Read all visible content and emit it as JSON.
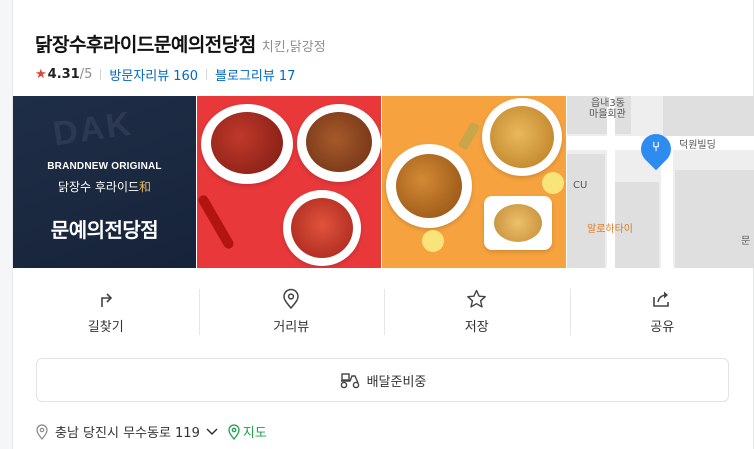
{
  "place": {
    "title": "닭장수후라이드문예의전당점",
    "category": "치킨,닭강정"
  },
  "rating": {
    "star_icon": "star-icon",
    "value": "4.31",
    "max": "/5"
  },
  "reviews": {
    "visit_label": "방문자리뷰",
    "visit_count": "160",
    "blog_label": "블로그리뷰",
    "blog_count": "17"
  },
  "photo_logo": {
    "bg_word": "DAK",
    "brand_line": "BRANDNEW ORIGINAL",
    "sub_line": "닭장수 후라이드",
    "sub_accent": "和",
    "main_line": "문예의전당점"
  },
  "map_thumb": {
    "label_1": "읍내3동",
    "label_2": "마을회관",
    "label_3": "덕원빌딩",
    "label_4": "CU",
    "label_5": "알로하타이",
    "label_6": "문"
  },
  "actions": [
    {
      "label": "길찾기",
      "icon": "directions-icon"
    },
    {
      "label": "거리뷰",
      "icon": "street-view-pin-icon"
    },
    {
      "label": "저장",
      "icon": "star-outline-icon"
    },
    {
      "label": "공유",
      "icon": "share-icon"
    }
  ],
  "delivery": {
    "label": "배달준비중",
    "icon": "delivery-scooter-icon"
  },
  "address": {
    "text": "충남 당진시 무수동로 119",
    "map_link": "지도"
  },
  "colors": {
    "accent_blue": "#0068c3",
    "star_red": "#e44232",
    "map_green": "#1aa34a",
    "pin_blue": "#2e8cf0"
  }
}
